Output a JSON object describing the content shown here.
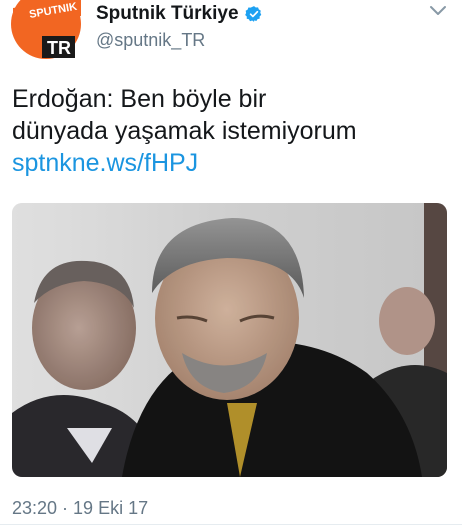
{
  "author": {
    "display_name": "Sputnik Türkiye",
    "handle": "@sputnik_TR",
    "avatar_text_top": "SPUTNIK",
    "avatar_text_bottom": "TR",
    "avatar_color": "#f26622",
    "verified_color": "#1da1f2"
  },
  "tweet": {
    "text_line1": "Erdoğan: Ben böyle bir",
    "text_line2": "dünyada yaşamak istemiyorum",
    "link": "sptnkne.ws/fHPJ",
    "timestamp": "23:20 · 19 Eki 17",
    "link_color": "#1b95e0"
  },
  "icons": {
    "verified": "verified-badge-icon",
    "menu": "chevron-down-icon"
  }
}
